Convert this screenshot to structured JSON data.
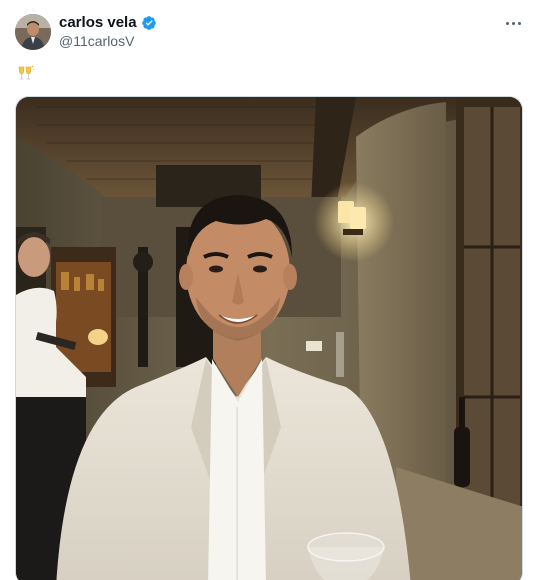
{
  "author": {
    "display_name": "carlos vela",
    "handle": "@11carlosV",
    "verified": true,
    "avatar_icon": "profile-photo",
    "verified_icon": "verified-badge-icon"
  },
  "tweet": {
    "emoji_icon": "clinking-glasses-icon",
    "media_icon": "photo"
  },
  "menu": {
    "icon": "more-options-icon"
  },
  "colors": {
    "verified_blue": "#1d9bf0",
    "handle_gray": "#536471",
    "text": "#0f1419",
    "border": "#cfd9de"
  }
}
